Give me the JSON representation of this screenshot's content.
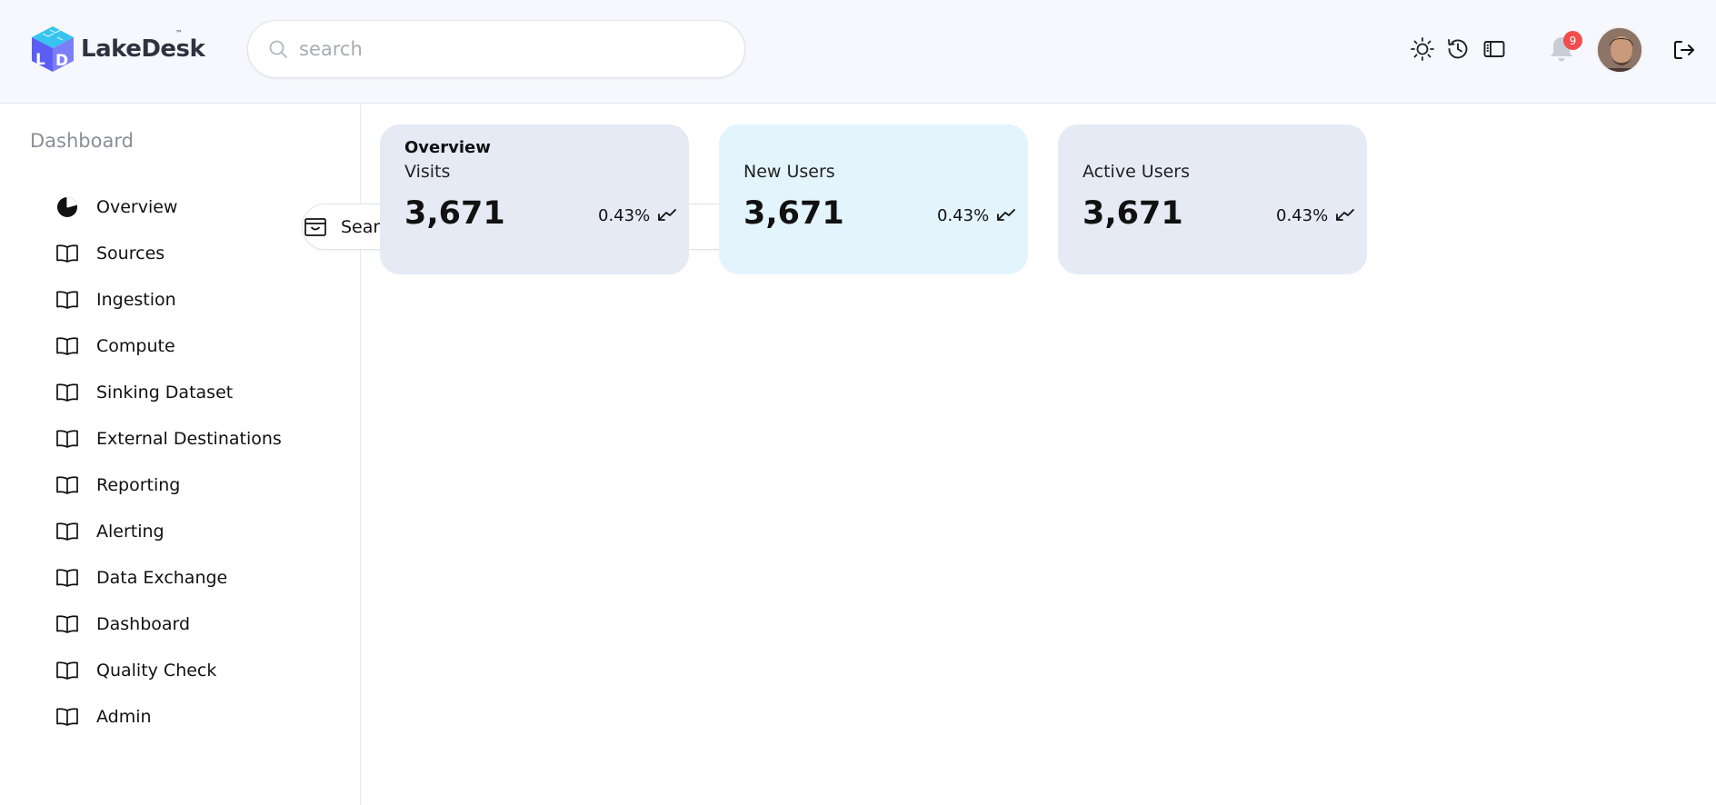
{
  "header": {
    "brand": "LakeDesk",
    "trademark": "™",
    "search_placeholder": "search",
    "notification_count": "9",
    "icons": [
      "sun-icon",
      "history-icon",
      "sidebar-toggle-icon",
      "bell-icon",
      "logout-icon"
    ]
  },
  "sidebar": {
    "title": "Dashboard",
    "items": [
      {
        "label": "Overview",
        "icon": "pie-chart-icon"
      },
      {
        "label": "Search Explore",
        "icon": "inbox-icon"
      },
      {
        "label": "Sources",
        "icon": "book-icon"
      },
      {
        "label": "Ingestion",
        "icon": "book-icon"
      },
      {
        "label": "Compute",
        "icon": "book-icon"
      },
      {
        "label": "Sinking Dataset",
        "icon": "book-icon"
      },
      {
        "label": "External Destinations",
        "icon": "book-icon"
      },
      {
        "label": "Reporting",
        "icon": "book-icon"
      },
      {
        "label": "Alerting",
        "icon": "book-icon"
      },
      {
        "label": "Data Exchange",
        "icon": "book-icon"
      },
      {
        "label": "Dashboard",
        "icon": "book-icon"
      },
      {
        "label": "Quality Check",
        "icon": "book-icon"
      },
      {
        "label": "Admin",
        "icon": "book-icon"
      }
    ]
  },
  "main": {
    "heading": "Overview",
    "cards": [
      {
        "label": "Visits",
        "value": "3,671",
        "change": "0.43%",
        "icon": "trend-down-icon",
        "bg": "#e5eaf5"
      },
      {
        "label": "New Users",
        "value": "3,671",
        "change": "0.43%",
        "icon": "trend-down-icon",
        "bg": "#e3f4fd"
      },
      {
        "label": "Active Users",
        "value": "3,671",
        "change": "0.43%",
        "icon": "trend-down-icon",
        "bg": "#e5eaf5"
      }
    ]
  },
  "colors": {
    "header_bg": "#f6f8fd",
    "badge": "#f24c4c",
    "logo_blue": "#4a6cf7",
    "logo_cyan": "#36c5f0"
  }
}
